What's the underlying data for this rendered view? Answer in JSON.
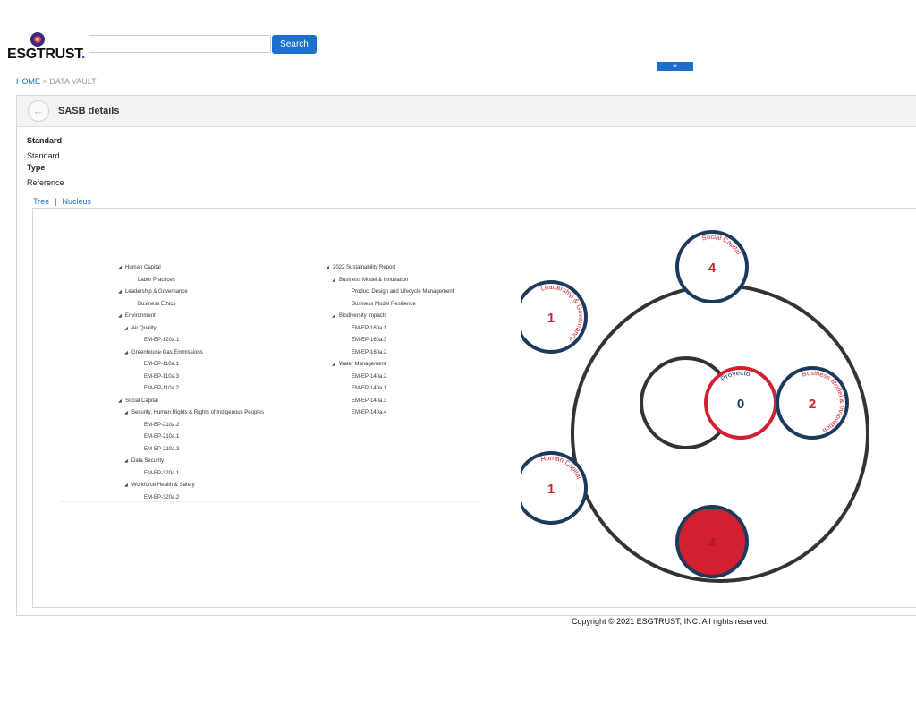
{
  "brand": {
    "name": "ESGTRUST",
    "dot": "."
  },
  "search": {
    "value": "",
    "placeholder": "",
    "button_label": "Search"
  },
  "menu": {
    "icon": "≡"
  },
  "breadcrumb": {
    "home": "HOME",
    "separator": ">",
    "current": "DATA VAULT"
  },
  "panel": {
    "title": "SASB details",
    "fields": [
      {
        "label": "Standard",
        "value": "Standard"
      },
      {
        "label": "Type",
        "value": "Reference"
      }
    ],
    "tabs": [
      "Tree",
      "Nucleus"
    ],
    "tab_separator": "|"
  },
  "tree_left": [
    {
      "text": "Human Capital",
      "level": 0,
      "expanded": true
    },
    {
      "text": "Labor Practices",
      "level": 1,
      "expanded": false
    },
    {
      "text": "Leadership & Governance",
      "level": 0,
      "expanded": true
    },
    {
      "text": "Business Ethics",
      "level": 1,
      "expanded": false
    },
    {
      "text": "Environment",
      "level": 0,
      "expanded": true
    },
    {
      "text": "Air Quality",
      "level": 1,
      "expanded": true
    },
    {
      "text": "EM-EP-120a.1",
      "level": 2,
      "expanded": false
    },
    {
      "text": "Greenhouse Gas Emmissions",
      "level": 1,
      "expanded": true
    },
    {
      "text": "EM-EP-110a.1",
      "level": 2,
      "expanded": false
    },
    {
      "text": "EM-EP-110a.3",
      "level": 2,
      "expanded": false
    },
    {
      "text": "EM-EP-110a.2",
      "level": 2,
      "expanded": false
    },
    {
      "text": "Social Capital",
      "level": 0,
      "expanded": true
    },
    {
      "text": "Security, Human Rights & Rights of Indigenous Peoples",
      "level": 1,
      "expanded": true
    },
    {
      "text": "EM-EP-210a.2",
      "level": 2,
      "expanded": false
    },
    {
      "text": "EM-EP-210a.1",
      "level": 2,
      "expanded": false
    },
    {
      "text": "EM-EP-210a.3",
      "level": 2,
      "expanded": false
    },
    {
      "text": "Data Security",
      "level": 1,
      "expanded": true
    },
    {
      "text": "EM-EP-320a.1",
      "level": 2,
      "expanded": false
    },
    {
      "text": "Workforce Health & Safety",
      "level": 1,
      "expanded": true
    },
    {
      "text": "EM-EP-320a.2",
      "level": 2,
      "expanded": false
    }
  ],
  "tree_right": [
    {
      "text": "2022 Sustainability Report",
      "level": 0,
      "expanded": true
    },
    {
      "text": "Business Model & Innovation",
      "level": 1,
      "expanded": true
    },
    {
      "text": "Product Design and Lifecycle Management",
      "level": 2,
      "expanded": false
    },
    {
      "text": "Business Model Resilience",
      "level": 2,
      "expanded": false
    },
    {
      "text": "Biodiversity Impacts",
      "level": 1,
      "expanded": true
    },
    {
      "text": "EM-EP-160a.1",
      "level": 2,
      "expanded": false
    },
    {
      "text": "EM-EP-160a.3",
      "level": 2,
      "expanded": false
    },
    {
      "text": "EM-EP-160a.2",
      "level": 2,
      "expanded": false
    },
    {
      "text": "Water Management",
      "level": 1,
      "expanded": true
    },
    {
      "text": "EM-EP-140a.2",
      "level": 2,
      "expanded": false
    },
    {
      "text": "EM-EP-140a.1",
      "level": 2,
      "expanded": false
    },
    {
      "text": "EM-EP-140a.3",
      "level": 2,
      "expanded": false
    },
    {
      "text": "EM-EP-140a.4",
      "level": 2,
      "expanded": false
    }
  ],
  "nucleus": {
    "center": {
      "label": "Proyecto",
      "count": "0"
    },
    "nodes": [
      {
        "label": "Social Capital",
        "count": "4",
        "filled": false
      },
      {
        "label": "Leadership & Governance",
        "count": "1",
        "filled": false
      },
      {
        "label": "Business Model & Innovation",
        "count": "2",
        "filled": false
      },
      {
        "label": "Human Capital",
        "count": "1",
        "filled": false
      },
      {
        "label": "",
        "count": "4",
        "filled": true
      }
    ],
    "colors": {
      "ring": "#333333",
      "node_border": "#1c3a5e",
      "accent": "#d32030"
    }
  },
  "footer": {
    "copyright": "Copyright © 2021 ESGTRUST, INC. All rights reserved."
  }
}
